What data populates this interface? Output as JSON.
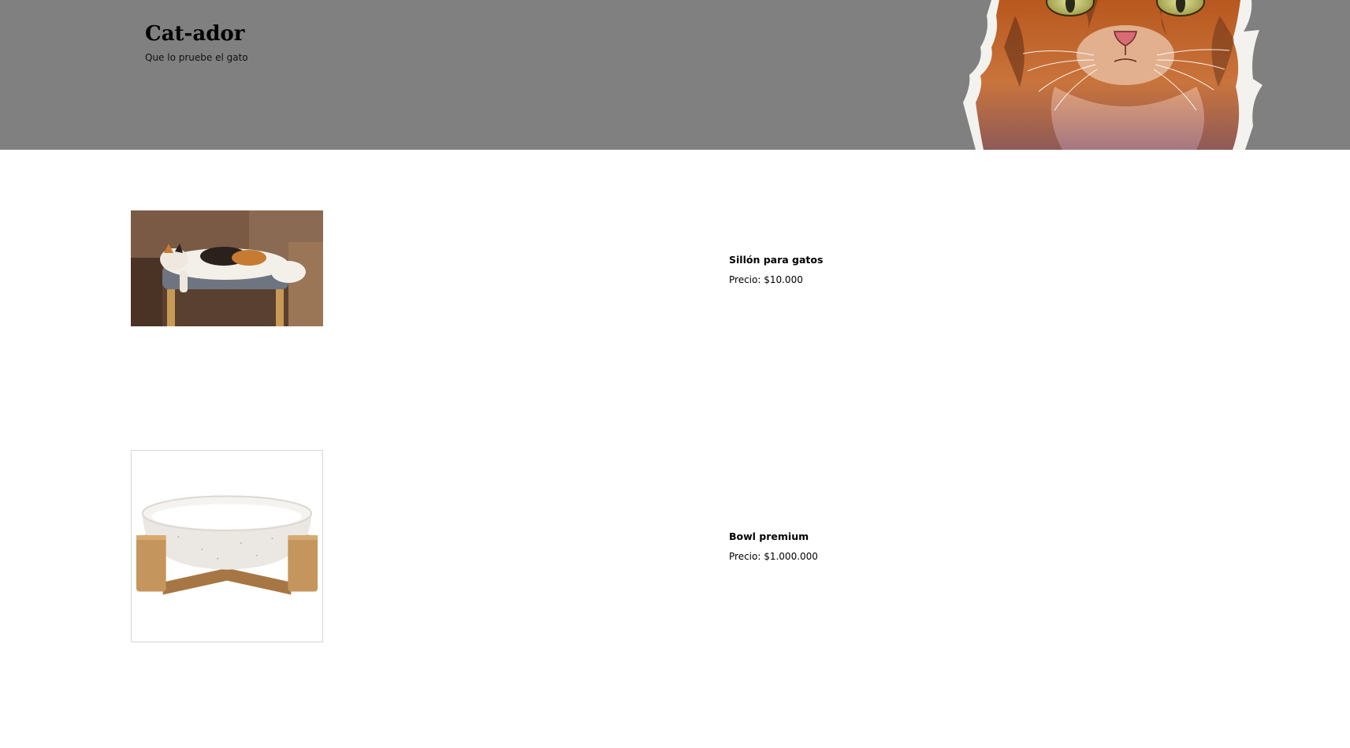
{
  "header": {
    "title": "Cat-ador",
    "tagline": "Que lo pruebe el gato",
    "background_color": "#808080",
    "mascot_icon": "cat-illustration"
  },
  "products": [
    {
      "name": "Sillón para gatos",
      "price": "Precio: $10.000",
      "image_icon": "calico-cat-on-chair-photo"
    },
    {
      "name": "Bowl premium",
      "price": "Precio: $1.000.000",
      "image_icon": "ceramic-bowl-wooden-stand-photo"
    }
  ]
}
